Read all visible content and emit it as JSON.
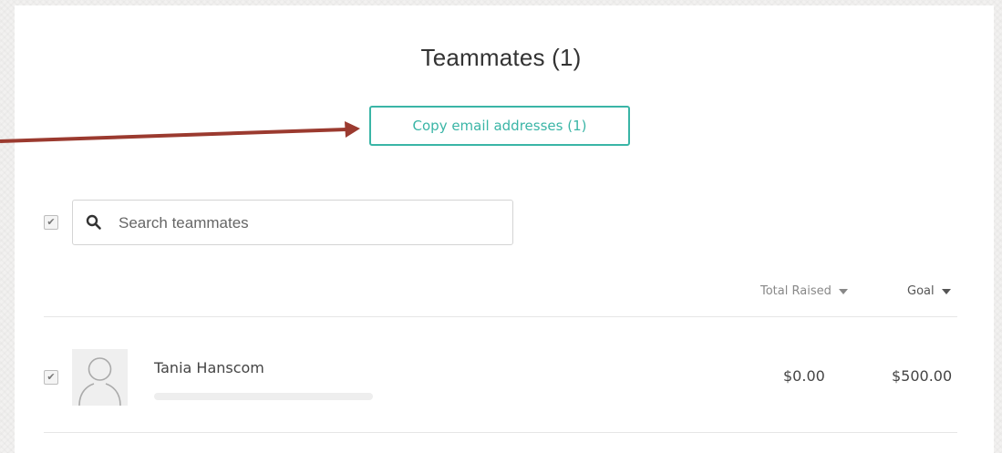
{
  "header": {
    "title": "Teammates (1)",
    "copy_button_label": "Copy email addresses (1)"
  },
  "search": {
    "placeholder": "Search teammates",
    "value": "",
    "select_all_checked": true
  },
  "table": {
    "columns": [
      {
        "label": "Total Raised",
        "sort": "desc"
      },
      {
        "label": "Goal",
        "sort": "desc"
      }
    ],
    "rows": [
      {
        "checked": true,
        "name": "Tania Hanscom",
        "total_raised": "$0.00",
        "goal": "$500.00",
        "progress_fraction": 0.0
      }
    ]
  },
  "colors": {
    "accent": "#3ab5a6",
    "annotation_arrow": "#9b3a2f"
  },
  "icons": {
    "search": "search-icon",
    "checkbox": "checkmark-icon",
    "avatar": "user-placeholder-icon",
    "sort": "caret-down-icon"
  }
}
